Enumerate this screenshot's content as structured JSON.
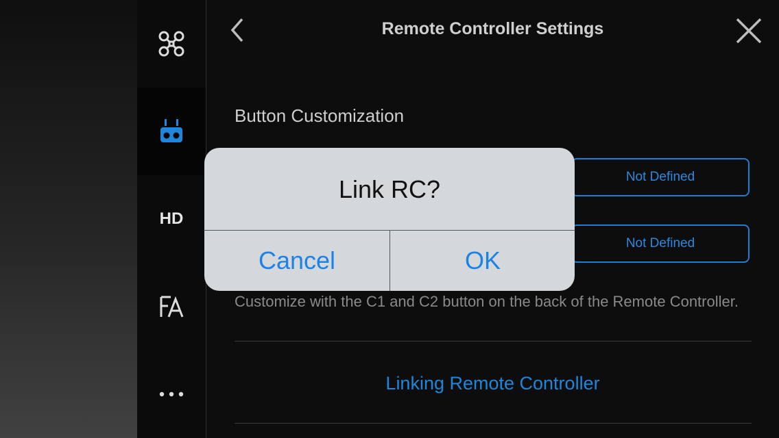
{
  "header": {
    "title": "Remote Controller Settings"
  },
  "sidebar": {
    "items": [
      {
        "icon": "drone-icon"
      },
      {
        "icon": "remote-controller-icon",
        "active": true
      },
      {
        "label": "HD"
      },
      {
        "icon": "language-icon"
      },
      {
        "icon": "more-icon"
      }
    ]
  },
  "main": {
    "section_heading": "Button Customization",
    "c1_value": "Not Defined",
    "c2_value": "Not Defined",
    "hint": "Customize with the C1 and C2 button on the back of the Remote Controller.",
    "link_label": "Linking Remote Controller"
  },
  "dialog": {
    "title": "Link RC?",
    "cancel_label": "Cancel",
    "ok_label": "OK"
  },
  "colors": {
    "accent": "#1f86dc",
    "background": "#0d0d0d",
    "dialog_bg": "#d4d8da"
  }
}
